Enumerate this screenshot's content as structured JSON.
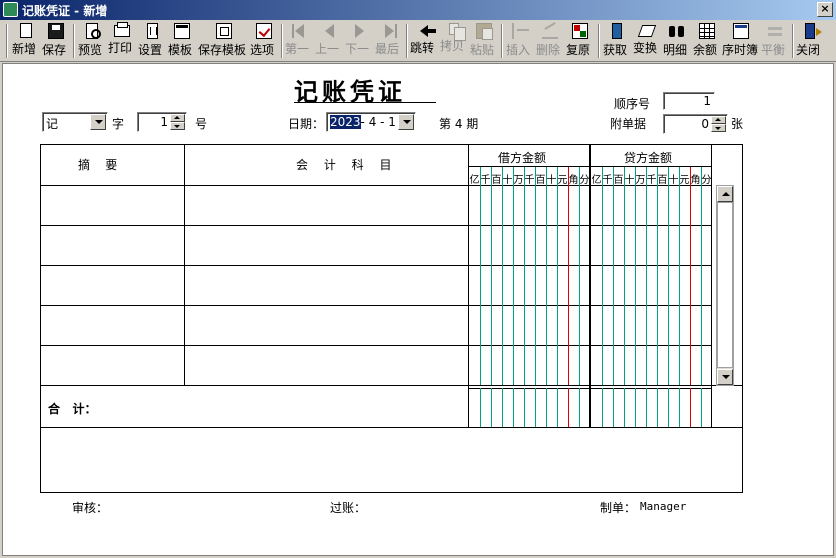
{
  "window": {
    "title": "记账凭证 - 新增",
    "close_label": "×"
  },
  "toolbar": {
    "buttons": [
      {
        "label": "新增",
        "icon": "new-page-icon",
        "enabled": true
      },
      {
        "label": "保存",
        "icon": "save-disk-icon",
        "enabled": true
      },
      {
        "label": "预览",
        "icon": "preview-icon",
        "enabled": true
      },
      {
        "label": "打印",
        "icon": "printer-icon",
        "enabled": true
      },
      {
        "label": "设置",
        "icon": "settings-doc-icon",
        "enabled": true
      },
      {
        "label": "模板",
        "icon": "template-icon",
        "enabled": true
      },
      {
        "label": "保存模板",
        "icon": "save-template-icon",
        "enabled": true
      },
      {
        "label": "选项",
        "icon": "options-check-icon",
        "enabled": true
      },
      {
        "label": "第一",
        "icon": "first-record-icon",
        "enabled": false
      },
      {
        "label": "上一",
        "icon": "previous-record-icon",
        "enabled": false
      },
      {
        "label": "下一",
        "icon": "next-record-icon",
        "enabled": false
      },
      {
        "label": "最后",
        "icon": "last-record-icon",
        "enabled": false
      },
      {
        "label": "跳转",
        "icon": "jump-arrow-icon",
        "enabled": true
      },
      {
        "label": "拷贝",
        "icon": "copy-icon",
        "enabled": false
      },
      {
        "label": "粘贴",
        "icon": "paste-icon",
        "enabled": false
      },
      {
        "label": "插入",
        "icon": "insert-row-icon",
        "enabled": false
      },
      {
        "label": "删除",
        "icon": "delete-row-icon",
        "enabled": false
      },
      {
        "label": "复原",
        "icon": "restore-icon",
        "enabled": true
      },
      {
        "label": "获取",
        "icon": "fetch-book-icon",
        "enabled": true
      },
      {
        "label": "变换",
        "icon": "transform-icon",
        "enabled": true
      },
      {
        "label": "明细",
        "icon": "binoculars-icon",
        "enabled": true
      },
      {
        "label": "余额",
        "icon": "balance-grid-icon",
        "enabled": true
      },
      {
        "label": "序时簿",
        "icon": "journal-book-icon",
        "enabled": true
      },
      {
        "label": "平衡",
        "icon": "balance-icon",
        "enabled": false
      },
      {
        "label": "关闭",
        "icon": "exit-door-icon",
        "enabled": true
      }
    ]
  },
  "voucher": {
    "title": "记账凭证",
    "word_type": "记",
    "word_label": "字",
    "number": "1",
    "number_label": "号",
    "date_label": "日期：",
    "date_year": "2023",
    "date_rest": "- 4 - 1",
    "period_text": "第 4 期",
    "seq_label": "顺序号",
    "seq_value": "1",
    "attach_label": "附单据",
    "attach_value": "0",
    "attach_unit": "张"
  },
  "table": {
    "col_summary": "摘    要",
    "col_account": "会 计 科 目",
    "debit_header": "借方金额",
    "credit_header": "贷方金额",
    "digits": [
      "亿",
      "千",
      "百",
      "十",
      "万",
      "千",
      "百",
      "十",
      "元",
      "角",
      "分"
    ],
    "total_label": "合   计："
  },
  "footer": {
    "review_label": "审核：",
    "post_label": "过账：",
    "maker_label": "制单：",
    "maker_value": "Manager"
  },
  "colors": {
    "titlebar_start": "#0a246a",
    "grid_green": "#00a080",
    "grid_red": "#e00000"
  }
}
